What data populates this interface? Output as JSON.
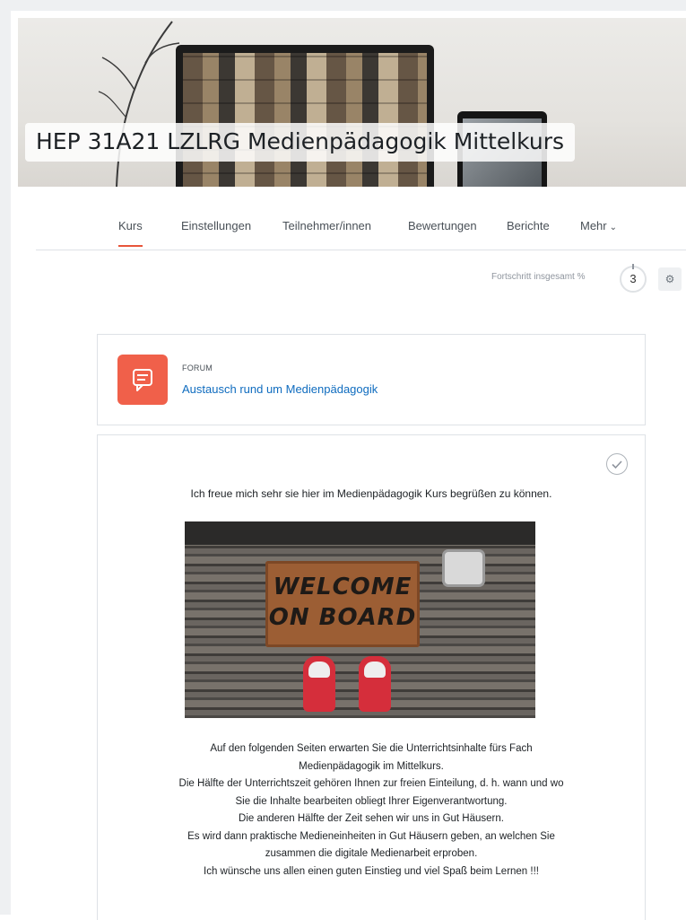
{
  "course": {
    "title": "HEP 31A21 LZLRG Medienpädagogik Mittelkurs"
  },
  "nav": {
    "items": [
      "Kurs",
      "Einstellungen",
      "Teilnehmer/innen",
      "Bewertungen",
      "Berichte",
      "Mehr"
    ],
    "active_index": 0,
    "more_chevron_icon": "chevron-down-icon"
  },
  "progress": {
    "label": "Fortschritt insgesamt %",
    "value": "3",
    "settings_icon": "gear-icon"
  },
  "forum": {
    "type": "FORUM",
    "name": "Austausch rund um Medienpädagogik",
    "icon": "forum-icon",
    "icon_color": "#f0604a"
  },
  "label": {
    "completion_icon": "check-circle-icon",
    "greeting": "Ich freue mich sehr sie hier im Medienpädagogik Kurs begrüßen zu können.",
    "image_text_line1": "WELCOME",
    "image_text_line2": "ON BOARD",
    "lines": [
      "Auf den folgenden Seiten erwarten Sie die Unterrichtsinhalte fürs Fach",
      "Medienpädagogik im Mittelkurs.",
      "Die Hälfte der Unterrichtszeit gehören Ihnen zur freien Einteilung, d. h. wann und wo",
      "Sie die Inhalte bearbeiten obliegt Ihrer Eigenverantwortung.",
      "Die anderen Hälfte der Zeit sehen wir uns in Gut Häusern.",
      "Es wird dann praktische Medieneinheiten in Gut Häusern geben, an welchen Sie",
      "zusammen die digitale Medienarbeit erproben.",
      "Ich wünsche uns allen einen guten Einstieg und viel Spaß beim Lernen !!!"
    ]
  },
  "colors": {
    "accent": "#e8553b",
    "link": "#0f6cbf"
  }
}
